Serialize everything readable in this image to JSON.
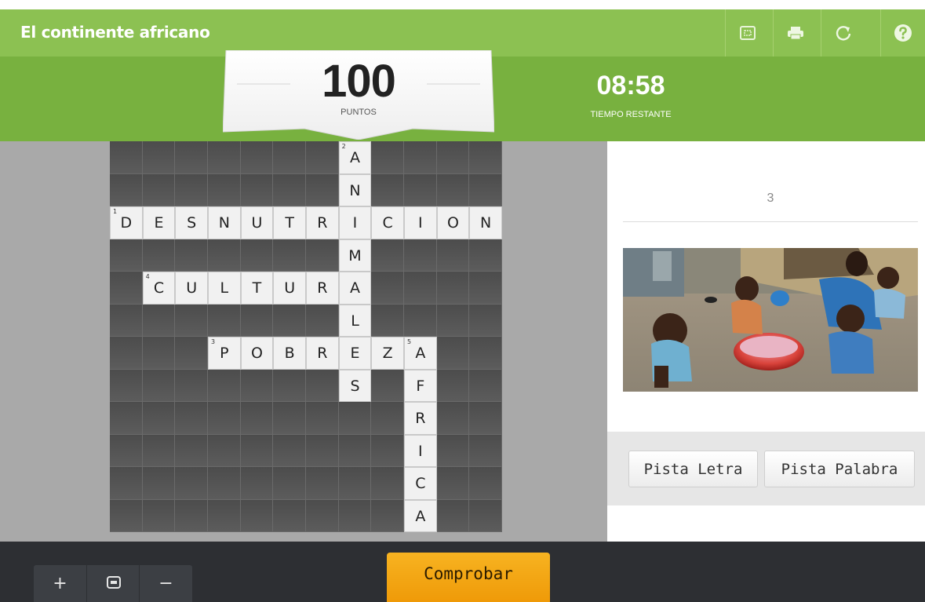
{
  "header": {
    "title": "El continente africano",
    "buttons": [
      {
        "name": "fullscreen-icon"
      },
      {
        "name": "print-icon"
      },
      {
        "name": "restart-icon"
      },
      {
        "name": "help-icon"
      }
    ]
  },
  "score": {
    "value": "100",
    "label": "PUNTOS"
  },
  "timer": {
    "value": "08:58",
    "label": "TIEMPO RESTANTE"
  },
  "crossword": {
    "cols": 12,
    "rows": 12,
    "words": [
      {
        "number": "1",
        "word": "DESNUTRICION",
        "direction": "across",
        "row": 2,
        "col": 0
      },
      {
        "number": "2",
        "word": "ANIMALES",
        "direction": "down",
        "row": 0,
        "col": 7
      },
      {
        "number": "3",
        "word": "POBREZA",
        "direction": "across",
        "row": 6,
        "col": 3
      },
      {
        "number": "4",
        "word": "CULTURA",
        "direction": "across",
        "row": 4,
        "col": 1
      },
      {
        "number": "5",
        "word": "AFRICA",
        "direction": "down",
        "row": 6,
        "col": 9
      }
    ]
  },
  "clue": {
    "number": "3",
    "image": "children-washing-hands-photo"
  },
  "hints": {
    "letter_label": "Pista Letra",
    "word_label": "Pista Palabra"
  },
  "zoom": {
    "in_label": "+",
    "fit_label": "",
    "out_label": "−"
  },
  "actions": {
    "check_label": "Comprobar"
  },
  "colors": {
    "header_green": "#8cc152",
    "infobar_green": "#78b13f",
    "grid_dark": "#505050",
    "letter_cell": "#f1f1f1",
    "check_orange": "#f2a40f",
    "bottom_bar": "#2d2f33"
  }
}
